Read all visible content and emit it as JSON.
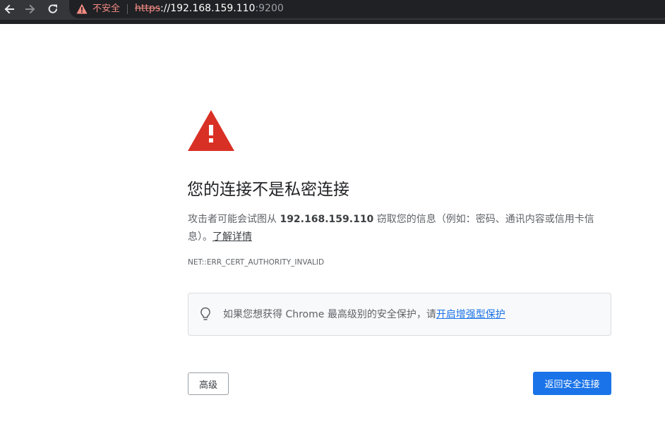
{
  "toolbar": {
    "back_icon": "arrow-left-icon",
    "forward_icon": "arrow-right-icon",
    "reload_icon": "reload-icon",
    "security_icon": "warning-triangle-icon",
    "security_text": "不安全",
    "url_scheme": "https",
    "url_host": "://192.168.159.110",
    "url_port": ":9200"
  },
  "interstitial": {
    "icon": "warning-triangle-icon",
    "heading": "您的连接不是私密连接",
    "desc_before": "攻击者可能会试图从 ",
    "desc_host": "192.168.159.110",
    "desc_after": " 窃取您的信息（例如：密码、通讯内容或信用卡信息）。",
    "learn_more": "了解详情",
    "error_code": "NET::ERR_CERT_AUTHORITY_INVALID",
    "tip_icon": "lightbulb-icon",
    "tip_text": "如果您想获得 Chrome 最高级别的安全保护，请",
    "tip_link": "开启增强型保护",
    "advanced_button": "高级",
    "back_button": "返回安全连接"
  },
  "colors": {
    "warning_red": "#d93025",
    "insecure_text": "#f28b82",
    "primary_blue": "#1a73e8",
    "toolbar_bg": "#35363a",
    "omnibox_bg": "#202124"
  }
}
